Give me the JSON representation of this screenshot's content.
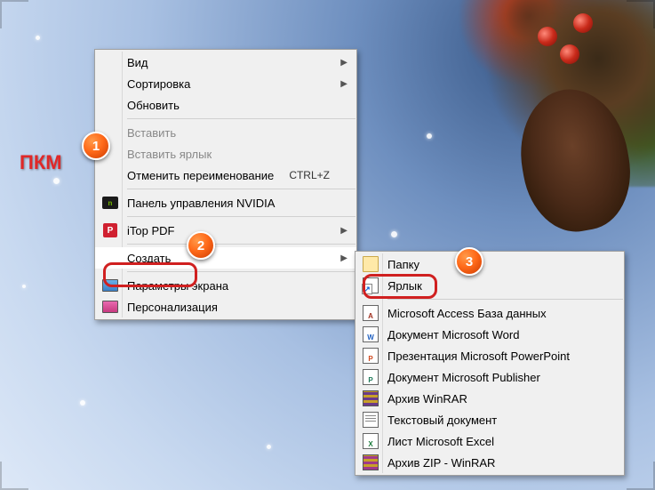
{
  "annotation": {
    "pkm_label": "ПКМ",
    "callouts": {
      "one": "1",
      "two": "2",
      "three": "3"
    }
  },
  "primary_menu": {
    "view": {
      "label": "Вид"
    },
    "sort": {
      "label": "Сортировка"
    },
    "refresh": {
      "label": "Обновить"
    },
    "paste": {
      "label": "Вставить"
    },
    "paste_short": {
      "label": "Вставить ярлык"
    },
    "undo": {
      "label": "Отменить переименование",
      "shortcut": "CTRL+Z"
    },
    "nvidia": {
      "label": "Панель управления NVIDIA"
    },
    "itop": {
      "label": "iTop PDF"
    },
    "create": {
      "label": "Создать"
    },
    "display": {
      "label": "Параметры экрана"
    },
    "personalize": {
      "label": "Персонализация"
    }
  },
  "submenu": {
    "folder": {
      "label": "Папку"
    },
    "shortcut": {
      "label": "Ярлык"
    },
    "access": {
      "label": "Microsoft Access База данных"
    },
    "word": {
      "label": "Документ Microsoft Word"
    },
    "ppt": {
      "label": "Презентация Microsoft PowerPoint"
    },
    "pub": {
      "label": "Документ Microsoft Publisher"
    },
    "rar": {
      "label": "Архив WinRAR"
    },
    "txt": {
      "label": "Текстовый документ"
    },
    "xls": {
      "label": "Лист Microsoft Excel"
    },
    "zip": {
      "label": "Архив ZIP - WinRAR"
    }
  }
}
